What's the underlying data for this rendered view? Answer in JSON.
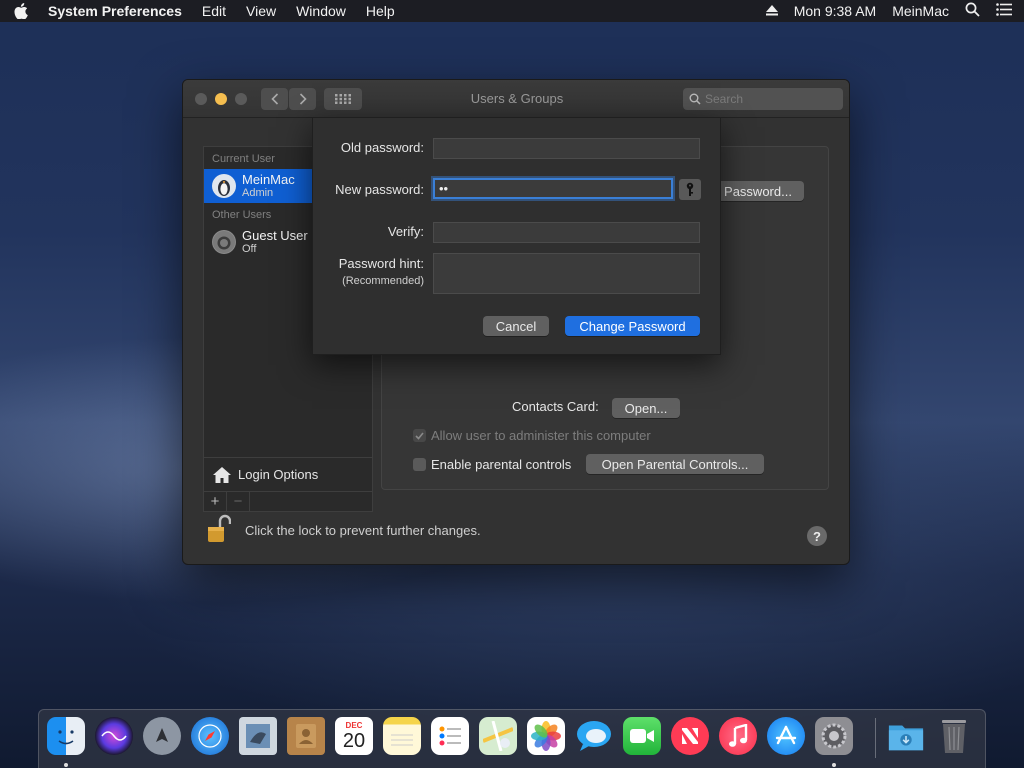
{
  "menubar": {
    "app_name": "System Preferences",
    "items": [
      "Edit",
      "View",
      "Window",
      "Help"
    ],
    "clock": "Mon 9:38 AM",
    "user": "MeinMac"
  },
  "window": {
    "title": "Users & Groups",
    "search_placeholder": "Search"
  },
  "userlist": {
    "current_label": "Current User",
    "current_user": {
      "name": "MeinMac",
      "role": "Admin"
    },
    "other_label": "Other Users",
    "guest_user": {
      "name": "Guest User",
      "status": "Off"
    },
    "login_options": "Login Options",
    "add": "+",
    "remove": "−"
  },
  "panel": {
    "password_button": "Password...",
    "contacts_label": "Contacts Card:",
    "open_button": "Open...",
    "allow_admin": "Allow user to administer this computer",
    "parental_label": "Enable parental controls",
    "parental_button": "Open Parental Controls..."
  },
  "footer": {
    "lock_text": "Click the lock to prevent further changes.",
    "help": "?"
  },
  "sheet": {
    "old_label": "Old password:",
    "new_label": "New password:",
    "new_value": "••",
    "verify_label": "Verify:",
    "hint_label": "Password hint:",
    "hint_sub": "(Recommended)",
    "cancel": "Cancel",
    "change": "Change Password"
  },
  "dock": {
    "calendar_month": "DEC",
    "calendar_day": "20"
  }
}
